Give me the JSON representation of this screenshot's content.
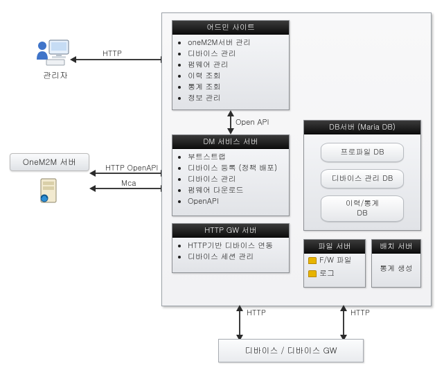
{
  "left": {
    "admin_label": "관리자",
    "onem2m_label": "OneM2M 서버"
  },
  "connectors": {
    "http1": "HTTP",
    "http_openapi": "HTTP OpenAPI",
    "mca": "Mca",
    "open_api_mid": "Open API",
    "http_gw_left": "HTTP",
    "http_gw_right": "HTTP"
  },
  "admin_site": {
    "title": "어드민 사이트",
    "items": [
      "oneM2M서버 관리",
      "디바이스 관리",
      "펌웨어 관리",
      "이력 조회",
      "통계 조회",
      "정보 관리"
    ]
  },
  "dm_server": {
    "title": "DM 서비스 서버",
    "items": [
      "부트스트랩",
      "디바이스 등록 (정책 배포)",
      "디바이스 관리",
      "펌웨어 다운로드",
      "OpenAPI"
    ]
  },
  "http_gw": {
    "title": "HTTP GW 서버",
    "items": [
      "HTTP기반 디바이스 연동",
      "디바이스 세션 관리"
    ]
  },
  "db_server": {
    "title": "DB서버 (Maria DB)",
    "cyl": [
      "프로파일 DB",
      "디바이스 관리 DB",
      "이력/통계\nDB"
    ]
  },
  "file_server": {
    "title": "파일 서버",
    "items": [
      "F/W 파일",
      "로그"
    ]
  },
  "batch_server": {
    "title": "배치 서버",
    "items": [
      "통계 생성"
    ]
  },
  "device_box": "디바이스 / 디바이스 GW"
}
